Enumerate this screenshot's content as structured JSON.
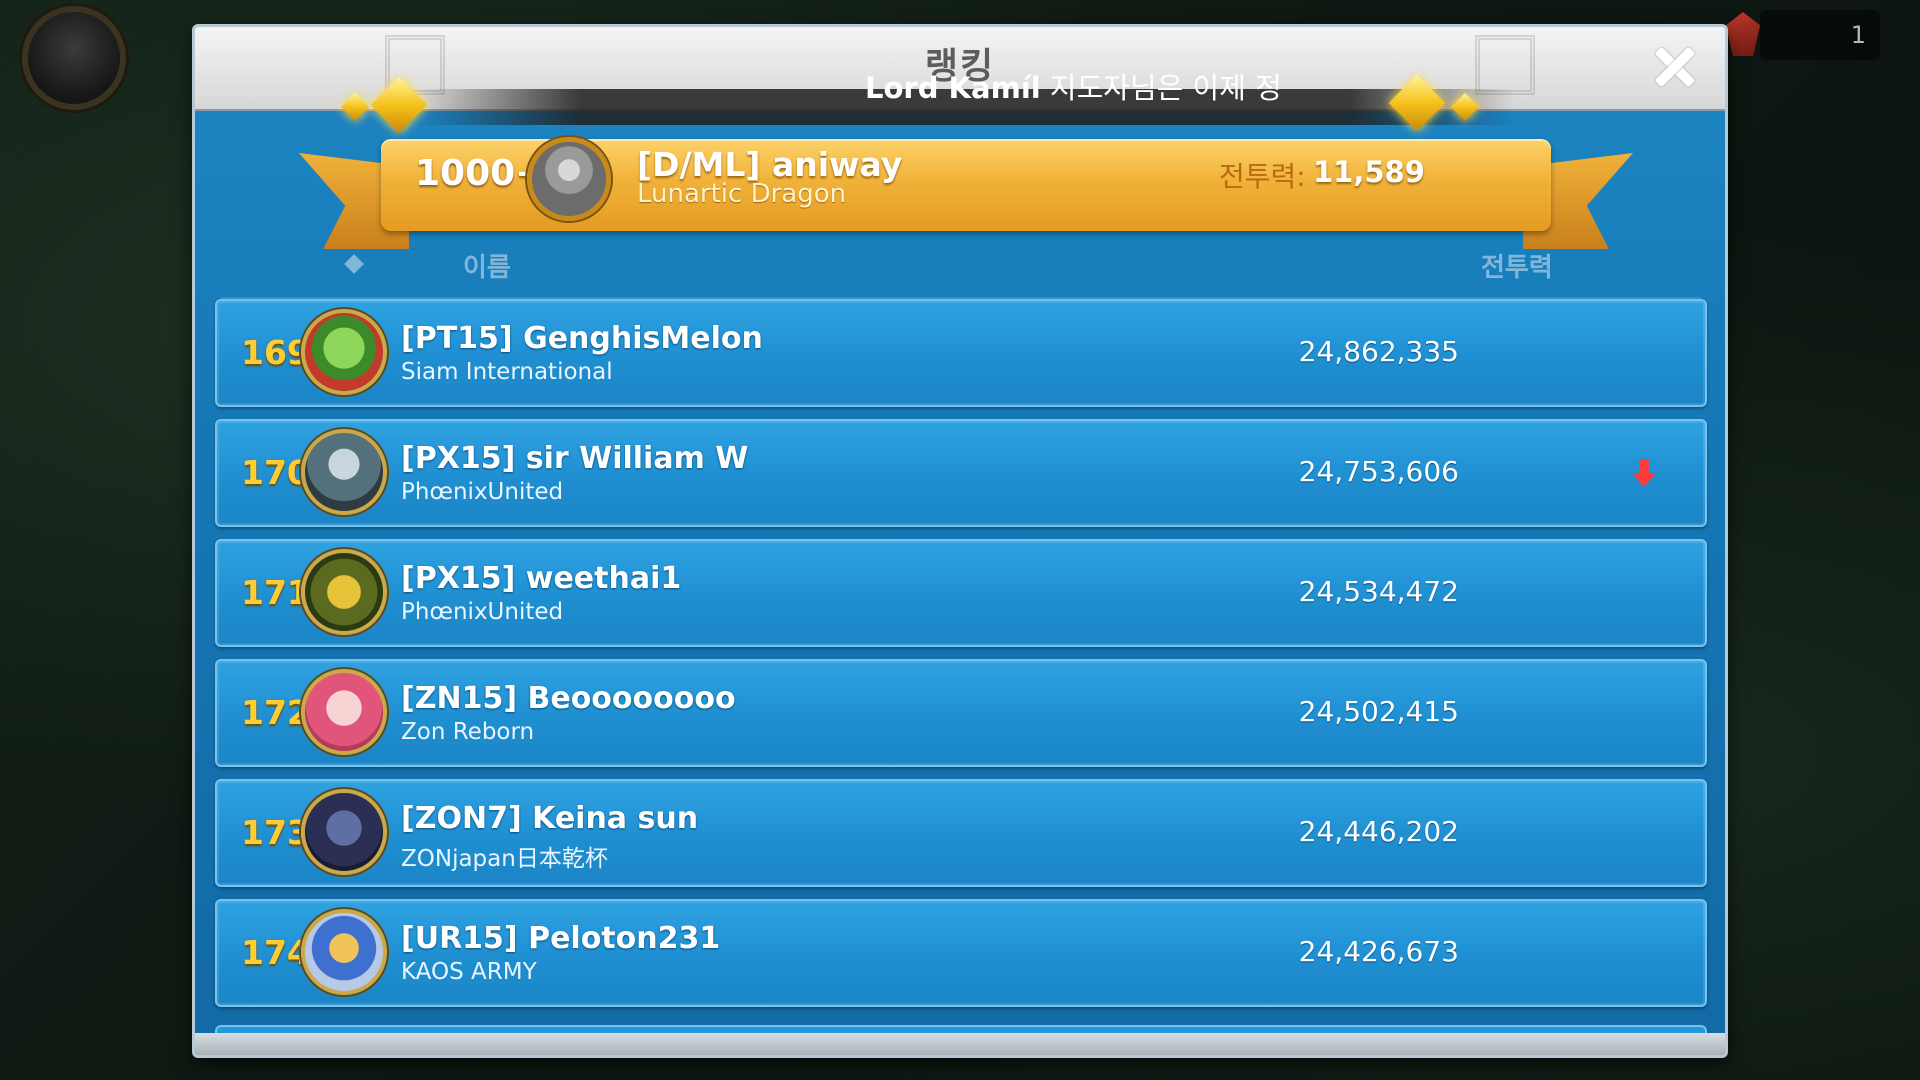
{
  "title": "랭킹",
  "ticker": {
    "prefix": "Lord Kamíl",
    "text": " 지도자님은 이제 정"
  },
  "hud": {
    "counter": "1"
  },
  "my_rank": {
    "rank": "1000+",
    "name": "[D/ML] aniway",
    "alliance": "Lunartic Dragon",
    "power_label": "전투력:",
    "power_value": "11,589"
  },
  "columns": {
    "name": "이름",
    "power": "전투력"
  },
  "rows": [
    {
      "rank": "169",
      "name": "[PT15] GenghisMelon",
      "alliance": "Siam International",
      "power": "24,862,335",
      "trend": "",
      "avatar_icon": "melon-avatar-icon"
    },
    {
      "rank": "170",
      "name": "[PX15] sir William W",
      "alliance": "PhœnixUnited",
      "power": "24,753,606",
      "trend": "down",
      "avatar_icon": "knight-avatar-icon"
    },
    {
      "rank": "171",
      "name": "[PX15] weethai1",
      "alliance": "PhœnixUnited",
      "power": "24,534,472",
      "trend": "",
      "avatar_icon": "robot-dog-avatar-icon"
    },
    {
      "rank": "172",
      "name": "[ZN15] Beoooooooo",
      "alliance": "Zon Reborn",
      "power": "24,502,415",
      "trend": "",
      "avatar_icon": "couple-photo-avatar-icon"
    },
    {
      "rank": "173",
      "name": "[ZON7] Keina sun",
      "alliance": "ZONjapan日本乾杯",
      "power": "24,446,202",
      "trend": "",
      "avatar_icon": "dark-creature-avatar-icon"
    },
    {
      "rank": "174",
      "name": "[UR15] Peloton231",
      "alliance": "KAOS ARMY",
      "power": "24,426,673",
      "trend": "",
      "avatar_icon": "toy-figure-avatar-icon"
    }
  ],
  "colors": {
    "rank_number": "#ffcc33",
    "row_bg": "#1f8fd1",
    "ribbon": "#f1b23a",
    "trend_down": "#ff3b3b"
  }
}
